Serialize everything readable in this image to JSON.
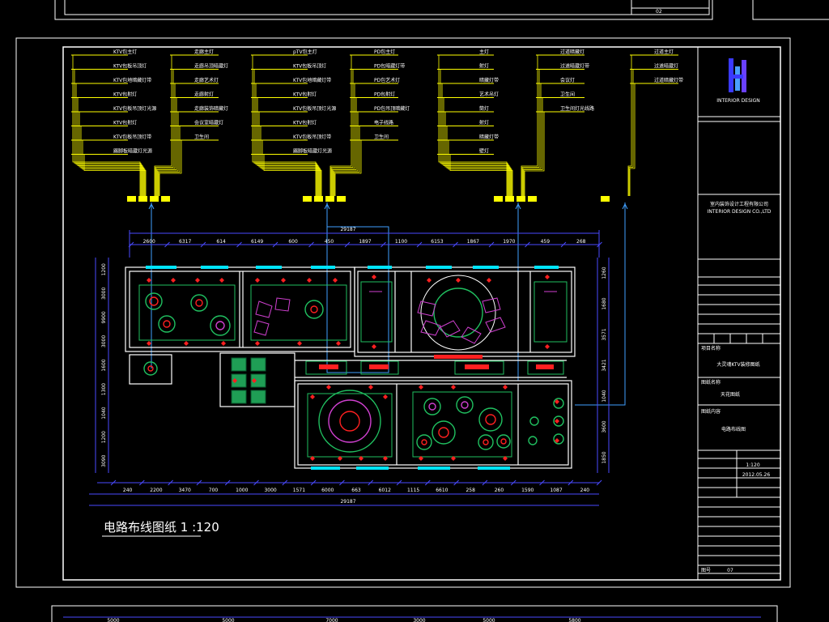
{
  "drawing": {
    "title": "电路布线图纸 1 :120",
    "sheet_top_label": "02",
    "sheet_number": "07",
    "overall_dim_top": "29187",
    "overall_dim_bottom": "29187",
    "top_dims": [
      "2600",
      "6317",
      "614",
      "6149",
      "600",
      "450",
      "1897",
      "1100",
      "6153",
      "1867",
      "1970",
      "459",
      "268"
    ],
    "bottom_dims": [
      "240",
      "2200",
      "3470",
      "700",
      "1000",
      "3000",
      "1571",
      "6000",
      "663",
      "6012",
      "1115",
      "6610",
      "258",
      "260",
      "1590",
      "1087",
      "240"
    ],
    "left_dims": [
      "1200",
      "3000",
      "9900",
      "3000",
      "1600",
      "1300",
      "1040",
      "1200",
      "3090"
    ],
    "right_dims": [
      "1260",
      "1680",
      "3571",
      "3421",
      "1040",
      "3600",
      "1850"
    ],
    "strip_dims": [
      "5000",
      "5000",
      "7000",
      "3000",
      "5000",
      "5800"
    ]
  },
  "legend_groups": [
    {
      "left_labels": [
        "KTV包主灯",
        "KTV包板吊顶灯",
        "KTV包地暗藏灯带",
        "KTV包射灯",
        "KTV包板吊顶灯光源",
        "KTV包射灯",
        "KTV包板吊顶灯带",
        "踢脚板暗藏灯光源"
      ],
      "right_labels": [
        "走廊主灯",
        "走廊吊顶暗藏灯",
        "走廊艺术灯",
        "走廊射灯",
        "走廊装饰暗藏灯",
        "会议室暗藏灯",
        "卫生间"
      ]
    },
    {
      "left_labels": [
        "pTV包主灯",
        "KTV包板吊顶灯",
        "KTV包地暗藏灯带",
        "KTV包射灯",
        "KTV包板吊顶灯光源",
        "KTV包射灯",
        "KTV包板吊顶灯带",
        "踢脚板暗藏灯光源"
      ],
      "right_labels": [
        "PD包主灯",
        "PD包暗藏灯带",
        "PD包艺术灯",
        "PD包射灯",
        "PD包吊顶暗藏灯",
        "电子线路",
        "卫生间"
      ]
    },
    {
      "left_labels": [
        "主灯",
        "射灯",
        "暗藏灯带",
        "艺术吊灯",
        "筒灯",
        "射灯",
        "暗藏灯带",
        "壁灯"
      ],
      "right_labels": [
        "过道暗藏灯",
        "过道暗藏灯带",
        "会议灯",
        "卫生间",
        "卫生间灯光线路"
      ]
    },
    {
      "left_labels": [],
      "right_labels": [
        "过道主灯",
        "过道暗藏灯",
        "过道暗藏灯带"
      ]
    }
  ],
  "title_block": {
    "company_line1": "室内装饰设计工程有限公司",
    "company_line2": "INTERIOR DESIGN CO.,LTD",
    "logo_caption": "INTERIOR DESIGN",
    "project_label": "项目名称",
    "project_name": "大灵魂KTV装修图纸",
    "drawing_label": "图纸名称",
    "drawing_name": "天花图纸",
    "sheet_label": "图纸内容",
    "sheet_name": "电路布线图",
    "scale": "1:120",
    "date": "2012.05.26",
    "number_label": "图号"
  },
  "colors": {
    "background": "#000000",
    "frame": "#ffffff",
    "wiring": "#ffff00",
    "dimension": "#4a4aff",
    "wall": "#ffffff",
    "fixture_red": "#ff2020",
    "fixture_green": "#20c060",
    "fixture_magenta": "#d040d0",
    "window": "#00e5ff",
    "cyan_line": "#40a0ff"
  }
}
